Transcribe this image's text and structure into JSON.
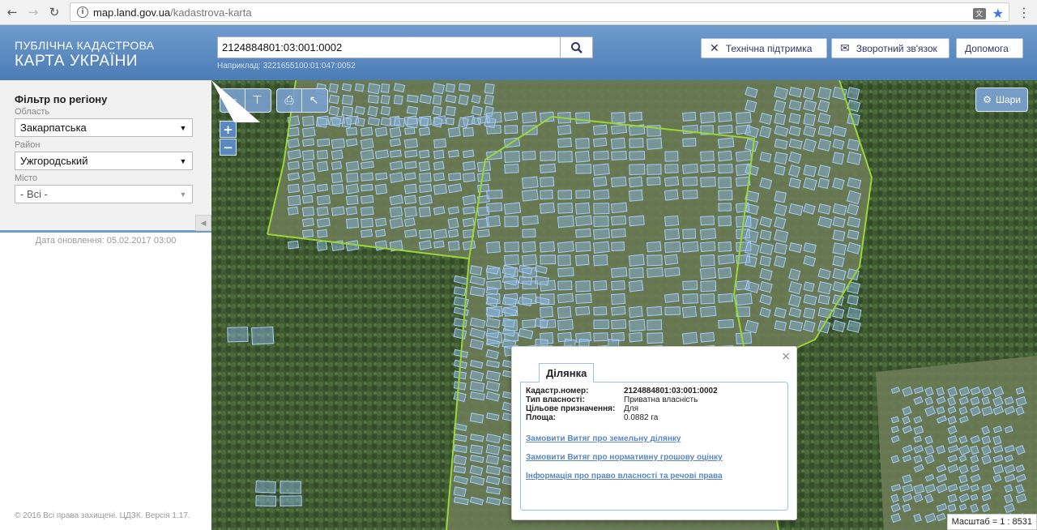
{
  "browser": {
    "url_host": "map.land.gov.ua",
    "url_path": "/kadastrova-karta",
    "back_icon": "arrow-left-icon",
    "forward_icon": "arrow-right-icon",
    "reload_icon": "reload-icon"
  },
  "header": {
    "brand_line1": "ПУБЛІЧНА КАДАСТРОВА",
    "brand_line2": "КАРТА УКРАЇНИ",
    "search_value": "2124884801:03:001:0002",
    "search_hint": "Наприклад: 3221655100:01:047:0052",
    "support_label": "Технічна підтримка",
    "feedback_label": "Зворотний зв'язок",
    "help_label": "Допомога"
  },
  "filter": {
    "title": "Фільтр по регіону",
    "oblast_label": "Область",
    "oblast_value": "Закарпатська",
    "raion_label": "Район",
    "raion_value": "Ужгородський",
    "city_label": "Місто",
    "city_value": "- Всі -",
    "update_date": "Дата оновлення: 05.02.2017 03:00",
    "copyright": "© 2016 Всі права захищені. ЦДЗК. Версія 1.17."
  },
  "map": {
    "layers_label": "Шари",
    "zoom_in": "+",
    "zoom_out": "−",
    "scale_text": "Масштаб = 1 : 8531",
    "tools": [
      "measure-length-icon",
      "measure-area-icon",
      "print-icon",
      "identify-icon"
    ],
    "colors": {
      "parcel_fill": "#8fb8e8",
      "parcel_stroke": "#a8cdf5",
      "boundary": "#9ad63a",
      "forest": "#3f5a31"
    }
  },
  "popup": {
    "tab_label": "Ділянка",
    "rows": [
      {
        "key": "Кадастр.номер:",
        "value": "2124884801:03:001:0002"
      },
      {
        "key": "Тип власності:",
        "value": "Приватна власність"
      },
      {
        "key": "Цільове призначення:",
        "value": "Для"
      },
      {
        "key": "Площа:",
        "value": "0.0882 га"
      }
    ],
    "links": [
      "Замовити Витяг про земельну ділянку",
      "Замовити Витяг про нормативну грошову оцінку",
      "Інформація про право власності та речові права"
    ],
    "close": "×"
  }
}
